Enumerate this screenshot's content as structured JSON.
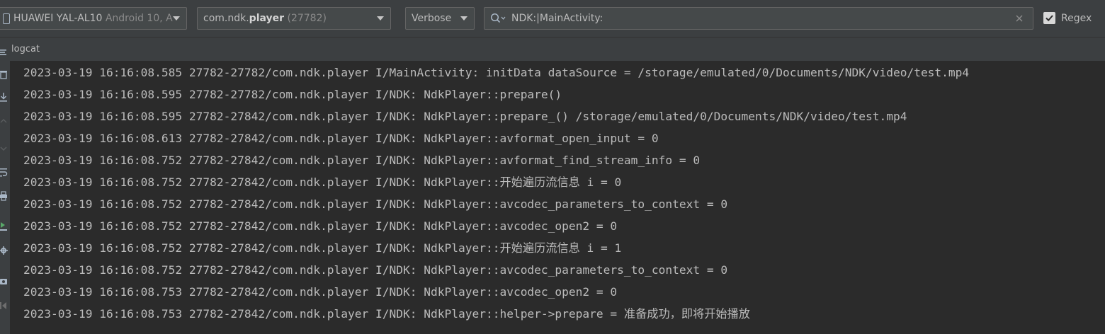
{
  "toolbar": {
    "device_name": "HUAWEI YAL-AL10",
    "device_os": "Android 10, A",
    "process_name_prefix": "com.ndk.",
    "process_name_bold": "player",
    "process_pid": "(27782)",
    "log_level": "Verbose",
    "search_value": "NDK:|MainActivity:",
    "regex_label": "Regex",
    "regex_checked": true
  },
  "panel": {
    "title": "logcat"
  },
  "log_lines": [
    "2023-03-19 16:16:08.585 27782-27782/com.ndk.player I/MainActivity: initData dataSource = /storage/emulated/0/Documents/NDK/video/test.mp4",
    "2023-03-19 16:16:08.595 27782-27782/com.ndk.player I/NDK: NdkPlayer::prepare()",
    "2023-03-19 16:16:08.595 27782-27842/com.ndk.player I/NDK: NdkPlayer::prepare_() /storage/emulated/0/Documents/NDK/video/test.mp4",
    "2023-03-19 16:16:08.613 27782-27842/com.ndk.player I/NDK: NdkPlayer::avformat_open_input = 0",
    "2023-03-19 16:16:08.752 27782-27842/com.ndk.player I/NDK: NdkPlayer::avformat_find_stream_info = 0",
    "2023-03-19 16:16:08.752 27782-27842/com.ndk.player I/NDK: NdkPlayer::开始遍历流信息 i = 0",
    "2023-03-19 16:16:08.752 27782-27842/com.ndk.player I/NDK: NdkPlayer::avcodec_parameters_to_context = 0",
    "2023-03-19 16:16:08.752 27782-27842/com.ndk.player I/NDK: NdkPlayer::avcodec_open2 = 0",
    "2023-03-19 16:16:08.752 27782-27842/com.ndk.player I/NDK: NdkPlayer::开始遍历流信息 i = 1",
    "2023-03-19 16:16:08.752 27782-27842/com.ndk.player I/NDK: NdkPlayer::avcodec_parameters_to_context = 0",
    "2023-03-19 16:16:08.753 27782-27842/com.ndk.player I/NDK: NdkPlayer::avcodec_open2 = 0",
    "2023-03-19 16:16:08.753 27782-27842/com.ndk.player I/NDK: NdkPlayer::helper->prepare = 准备成功，即将开始播放"
  ],
  "gutter_icons": [
    "restart-icon",
    "download-icon",
    "up-arrow-icon",
    "down-arrow-icon",
    "soft-wrap-icon",
    "print-icon",
    "restart-debug-icon",
    "settings-icon",
    "screenshot-icon",
    "screen-record-icon"
  ],
  "colors": {
    "background": "#2b2b2b",
    "toolbar": "#3c3f41",
    "text": "#bbbbbb",
    "accent_green": "#59a869"
  }
}
